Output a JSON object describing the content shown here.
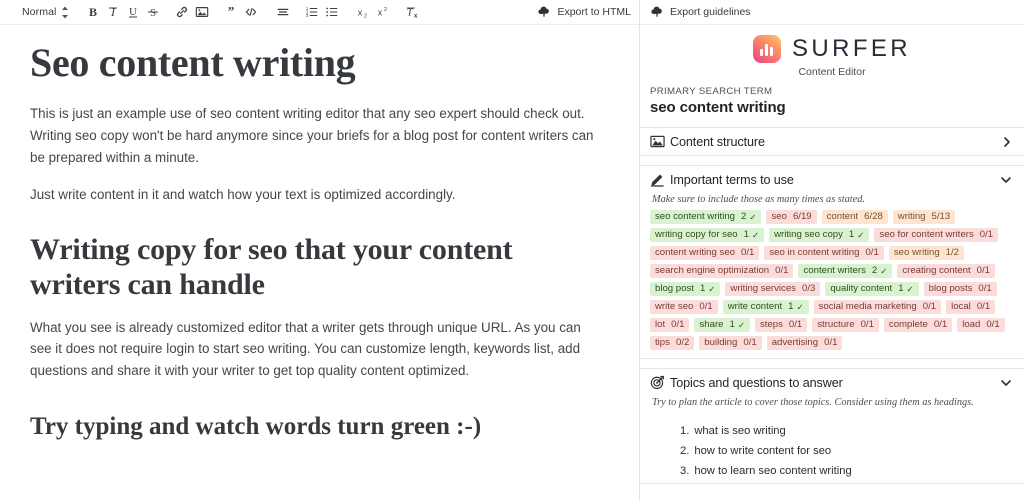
{
  "editor": {
    "toolbar": {
      "format_label": "Normal",
      "buttons": [
        {
          "name": "bold",
          "label": "B"
        },
        {
          "name": "italic",
          "label": "I"
        },
        {
          "name": "underline",
          "label": "U"
        },
        {
          "name": "strikethrough",
          "label": "S"
        },
        {
          "name": "link",
          "label": "link-icon"
        },
        {
          "name": "image",
          "label": "image-icon"
        },
        {
          "name": "blockquote",
          "label": "quote-icon"
        },
        {
          "name": "code",
          "label": "code-icon"
        },
        {
          "name": "align",
          "label": "align-icon"
        },
        {
          "name": "ordered-list",
          "label": "ordered-list-icon"
        },
        {
          "name": "bullet-list",
          "label": "bullet-list-icon"
        },
        {
          "name": "subscript",
          "label": "x2-sub"
        },
        {
          "name": "superscript",
          "label": "x2-sup"
        },
        {
          "name": "clear-formatting",
          "label": "Tx"
        }
      ],
      "export_label": "Export to HTML"
    },
    "document": {
      "title": "Seo content writing",
      "para1": "This is just an example use of seo content writing editor that any seo expert should check out. Writing seo copy won't be hard anymore since your briefs for a blog post for content writers can be prepared within a minute.",
      "para2": "Just write content in it and watch how your text is optimized accordingly.",
      "heading2": "Writing copy for seo that your content writers can handle",
      "para3": "What you see is already customized editor that a writer gets through unique URL. As you can see it does not require login to start seo writing.  You can customize length, keywords list, add questions and share it with your writer to get top quality content optimized.",
      "heading3": "Try typing and watch words turn green :-)"
    }
  },
  "sidebar": {
    "export_guidelines_label": "Export guidelines",
    "brand": {
      "wordmark": "SURFER",
      "subtitle": "Content Editor"
    },
    "primary_term": {
      "label": "PRIMARY SEARCH TERM",
      "value": "seo content writing"
    },
    "sections": {
      "content_structure": {
        "title": "Content structure",
        "icon": "image-icon",
        "expanded": false,
        "chevron": "chevron-right-icon"
      },
      "important_terms": {
        "title": "Important terms to use",
        "icon": "pencil-icon",
        "expanded": true,
        "chevron": "chevron-down-icon",
        "hint": "Make sure to include those as many times as stated.",
        "terms": [
          {
            "term": "seo content writing",
            "count": "2",
            "state": "done",
            "tick": "✓"
          },
          {
            "term": "seo",
            "count": "6/19",
            "state": "missing",
            "tick": ""
          },
          {
            "term": "content",
            "count": "6/28",
            "state": "partial",
            "tick": ""
          },
          {
            "term": "writing",
            "count": "5/13",
            "state": "partial",
            "tick": ""
          },
          {
            "term": "writing copy for seo",
            "count": "1",
            "state": "done",
            "tick": "✓"
          },
          {
            "term": "writing seo copy",
            "count": "1",
            "state": "done",
            "tick": "✓"
          },
          {
            "term": "seo for content writers",
            "count": "0/1",
            "state": "missing",
            "tick": ""
          },
          {
            "term": "content writing seo",
            "count": "0/1",
            "state": "missing",
            "tick": ""
          },
          {
            "term": "seo in content writing",
            "count": "0/1",
            "state": "missing",
            "tick": ""
          },
          {
            "term": "seo writing",
            "count": "1/2",
            "state": "partial",
            "tick": ""
          },
          {
            "term": "search engine optimization",
            "count": "0/1",
            "state": "missing",
            "tick": ""
          },
          {
            "term": "content writers",
            "count": "2",
            "state": "done",
            "tick": "✓"
          },
          {
            "term": "creating content",
            "count": "0/1",
            "state": "missing",
            "tick": ""
          },
          {
            "term": "blog post",
            "count": "1",
            "state": "done",
            "tick": "✓"
          },
          {
            "term": "writing services",
            "count": "0/3",
            "state": "missing",
            "tick": ""
          },
          {
            "term": "quality content",
            "count": "1",
            "state": "done",
            "tick": "✓"
          },
          {
            "term": "blog posts",
            "count": "0/1",
            "state": "missing",
            "tick": ""
          },
          {
            "term": "write seo",
            "count": "0/1",
            "state": "missing",
            "tick": ""
          },
          {
            "term": "write content",
            "count": "1",
            "state": "done",
            "tick": "✓"
          },
          {
            "term": "social media marketing",
            "count": "0/1",
            "state": "missing",
            "tick": ""
          },
          {
            "term": "local",
            "count": "0/1",
            "state": "missing",
            "tick": ""
          },
          {
            "term": "lot",
            "count": "0/1",
            "state": "missing",
            "tick": ""
          },
          {
            "term": "share",
            "count": "1",
            "state": "done",
            "tick": "✓"
          },
          {
            "term": "steps",
            "count": "0/1",
            "state": "missing",
            "tick": ""
          },
          {
            "term": "structure",
            "count": "0/1",
            "state": "missing",
            "tick": ""
          },
          {
            "term": "complete",
            "count": "0/1",
            "state": "missing",
            "tick": ""
          },
          {
            "term": "load",
            "count": "0/1",
            "state": "missing",
            "tick": ""
          },
          {
            "term": "tips",
            "count": "0/2",
            "state": "missing",
            "tick": ""
          },
          {
            "term": "building",
            "count": "0/1",
            "state": "missing",
            "tick": ""
          },
          {
            "term": "advertising",
            "count": "0/1",
            "state": "missing",
            "tick": ""
          }
        ]
      },
      "topics_questions": {
        "title": "Topics and questions to answer",
        "icon": "target-icon",
        "expanded": true,
        "chevron": "chevron-down-icon",
        "hint": "Try to plan the article to cover those topics. Consider using them as headings.",
        "questions": [
          {
            "num": "1.",
            "text": "what is seo writing"
          },
          {
            "num": "2.",
            "text": "how to write content for seo"
          },
          {
            "num": "3.",
            "text": "how to learn seo content writing"
          }
        ]
      }
    }
  },
  "colors": {
    "done_bg": "#d9f2cf",
    "missing_bg": "#fadcda",
    "partial_bg": "#fde5d1",
    "brand_gradient_from": "#ffc861",
    "brand_gradient_to": "#ef3f86"
  }
}
